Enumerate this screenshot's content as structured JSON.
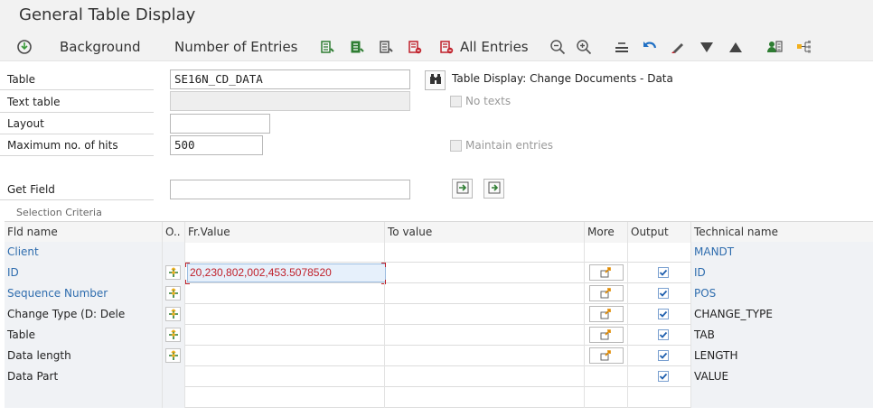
{
  "window": {
    "title": "General Table Display"
  },
  "toolbar": {
    "background_label": "Background",
    "number_of_entries_label": "Number of Entries",
    "all_entries_label": "All Entries"
  },
  "form": {
    "table_label": "Table",
    "table_value": "SE16N_CD_DATA",
    "table_desc": "Table Display: Change Documents - Data",
    "text_table_label": "Text table",
    "no_texts_label": "No texts",
    "layout_label": "Layout",
    "layout_value": "",
    "max_hits_label": "Maximum no. of hits",
    "max_hits_value": "500",
    "maintain_entries_label": "Maintain entries",
    "get_field_label": "Get Field",
    "get_field_value": ""
  },
  "selection": {
    "title": "Selection Criteria",
    "columns": {
      "fld_name": "Fld name",
      "op": "O..",
      "from": "Fr.Value",
      "to": "To value",
      "more": "More",
      "output": "Output",
      "tech": "Technical name"
    },
    "rows": [
      {
        "name": "Client",
        "from": "",
        "to": "",
        "output": false,
        "tech": "MANDT",
        "blue_name": true,
        "blue_tech": true,
        "has_op": false,
        "has_more": false
      },
      {
        "name": "ID",
        "from": "20,230,802,002,453.5078520",
        "to": "",
        "output": true,
        "tech": "ID",
        "blue_name": true,
        "blue_tech": true,
        "has_op": true,
        "has_more": true
      },
      {
        "name": "Sequence Number",
        "from": "",
        "to": "",
        "output": true,
        "tech": "POS",
        "blue_name": true,
        "blue_tech": true,
        "has_op": true,
        "has_more": true
      },
      {
        "name": "Change Type (D: Dele",
        "from": "",
        "to": "",
        "output": true,
        "tech": "CHANGE_TYPE",
        "blue_name": false,
        "blue_tech": false,
        "has_op": true,
        "has_more": true
      },
      {
        "name": "Table",
        "from": "",
        "to": "",
        "output": true,
        "tech": "TAB",
        "blue_name": false,
        "blue_tech": false,
        "has_op": true,
        "has_more": true
      },
      {
        "name": "Data length",
        "from": "",
        "to": "",
        "output": true,
        "tech": "LENGTH",
        "blue_name": false,
        "blue_tech": false,
        "has_op": true,
        "has_more": true
      },
      {
        "name": "Data Part",
        "from": "",
        "to": "",
        "output": true,
        "tech": "VALUE",
        "blue_name": false,
        "blue_tech": false,
        "has_op": false,
        "has_more": false
      }
    ]
  },
  "colors": {
    "accent_blue": "#2f6dae",
    "accent_red": "#c0202a",
    "icon_green": "#2e7d32"
  }
}
